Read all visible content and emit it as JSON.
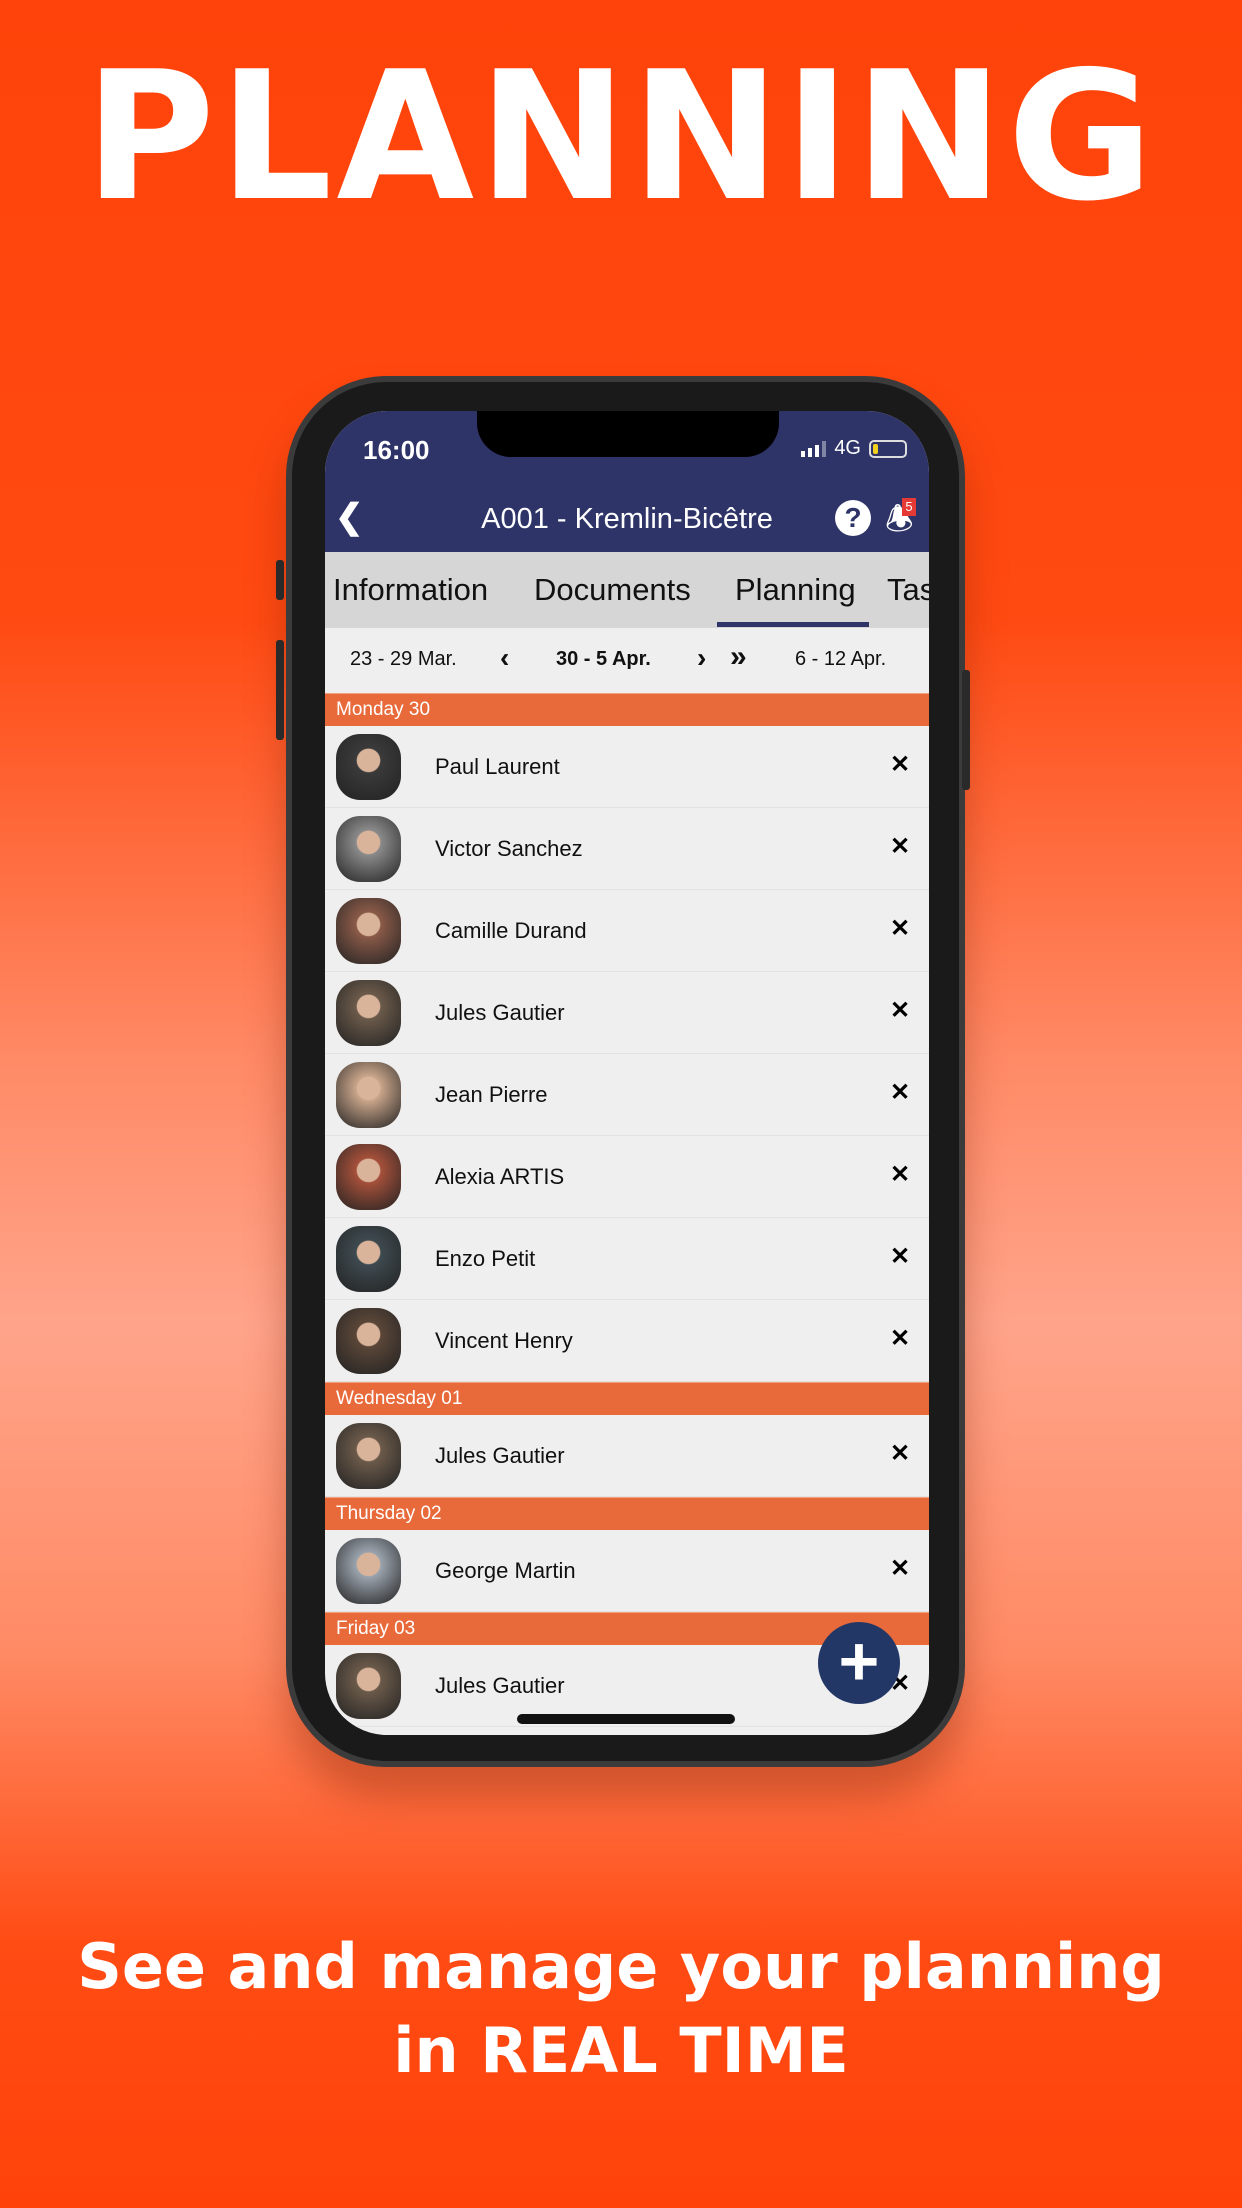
{
  "headline": "PLANNING",
  "tagline": {
    "line1": "See and manage your planning",
    "line2": "in REAL TIME"
  },
  "status_bar": {
    "time": "16:00",
    "network": "4G",
    "battery_level": 0.15
  },
  "header": {
    "title": "A001 - Kremlin-Bicêtre",
    "notification_count": "5",
    "back_icon": "chevron-left-icon",
    "help_icon": "question-circle-icon",
    "bell_icon": "bell-icon"
  },
  "tabs": [
    {
      "label": "Information"
    },
    {
      "label": "Documents"
    },
    {
      "label": "Planning",
      "active": true
    },
    {
      "label": "Tas"
    }
  ],
  "week_nav": {
    "previous": "23 - 29 Mar.",
    "current": "30 - 5 Apr.",
    "next": "6 - 12 Apr."
  },
  "days": [
    {
      "label": "Monday 30",
      "people": [
        {
          "name": "Paul Laurent",
          "color": "#3a3a3a"
        },
        {
          "name": "Victor Sanchez",
          "color": "#8a8a8a"
        },
        {
          "name": "Camille Durand",
          "color": "#8a5a48"
        },
        {
          "name": "Jules Gautier",
          "color": "#6b5a4a"
        },
        {
          "name": "Jean Pierre",
          "color": "#c9a58a"
        },
        {
          "name": "Alexia ARTIS",
          "color": "#a5503a"
        },
        {
          "name": "Enzo Petit",
          "color": "#3e4a50"
        },
        {
          "name": "Vincent Henry",
          "color": "#5a4638"
        }
      ]
    },
    {
      "label": "Wednesday 01",
      "people": [
        {
          "name": "Jules Gautier",
          "color": "#6b5a4a"
        }
      ]
    },
    {
      "label": "Thursday 02",
      "people": [
        {
          "name": "George Martin",
          "color": "#9aa3ad"
        }
      ]
    },
    {
      "label": "Friday 03",
      "people": [
        {
          "name": "Jules Gautier",
          "color": "#6b5a4a"
        }
      ]
    }
  ],
  "fab_icon": "plus-icon",
  "colors": {
    "background": "#ff430a",
    "nav": "#2e3468",
    "day_header": "#e86a3a",
    "fab": "#233767"
  }
}
